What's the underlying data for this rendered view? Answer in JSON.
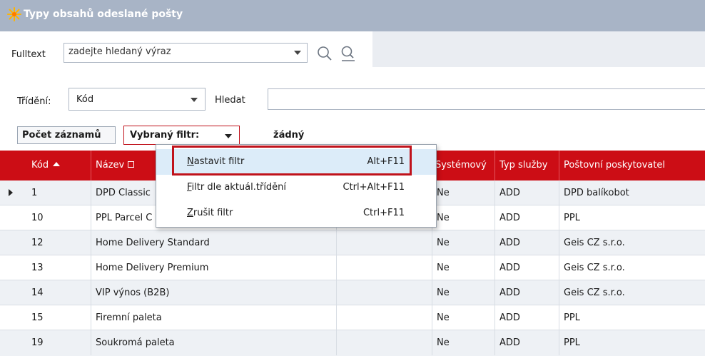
{
  "window": {
    "title": "Typy obsahů odeslané pošty"
  },
  "fulltext": {
    "label": "Fulltext",
    "placeholder": "zadejte hledaný výraz"
  },
  "sort": {
    "label": "Třídění:",
    "value": "Kód",
    "find_label": "Hledat",
    "find_value": ""
  },
  "filterbar": {
    "count_button": "Počet záznamů",
    "filter_label": "Vybraný filtr:",
    "filter_value": "žádný"
  },
  "grid": {
    "columns": [
      "Kód",
      "Název",
      "Systémový",
      "Typ služby",
      "Poštovní poskytovatel"
    ],
    "rows": [
      {
        "kod": "1",
        "nazev": "DPD Classic",
        "system": "Ne",
        "typ": "ADD",
        "posk": "DPD balíkobot"
      },
      {
        "kod": "10",
        "nazev": "PPL Parcel C",
        "system": "Ne",
        "typ": "ADD",
        "posk": "PPL"
      },
      {
        "kod": "12",
        "nazev": "Home Delivery Standard",
        "system": "Ne",
        "typ": "ADD",
        "posk": "Geis CZ s.r.o."
      },
      {
        "kod": "13",
        "nazev": "Home Delivery Premium",
        "system": "Ne",
        "typ": "ADD",
        "posk": "Geis CZ s.r.o."
      },
      {
        "kod": "14",
        "nazev": "VIP výnos (B2B)",
        "system": "Ne",
        "typ": "ADD",
        "posk": "Geis CZ s.r.o."
      },
      {
        "kod": "15",
        "nazev": "Firemní paleta",
        "system": "Ne",
        "typ": "ADD",
        "posk": "PPL"
      },
      {
        "kod": "19",
        "nazev": "Soukromá paleta",
        "system": "Ne",
        "typ": "ADD",
        "posk": "PPL"
      }
    ]
  },
  "menu": {
    "items": [
      {
        "accel": "N",
        "rest": "astavit filtr",
        "shortcut": "Alt+F11"
      },
      {
        "accel": "F",
        "rest": "iltr dle aktuál.třídění",
        "shortcut": "Ctrl+Alt+F11"
      },
      {
        "accel": "Z",
        "rest": "rušit filtr",
        "shortcut": "Ctrl+F11"
      }
    ]
  },
  "colors": {
    "accent": "#cc0d15",
    "titlebar": "#a8b4c6",
    "highlight": "#dcecf9"
  }
}
